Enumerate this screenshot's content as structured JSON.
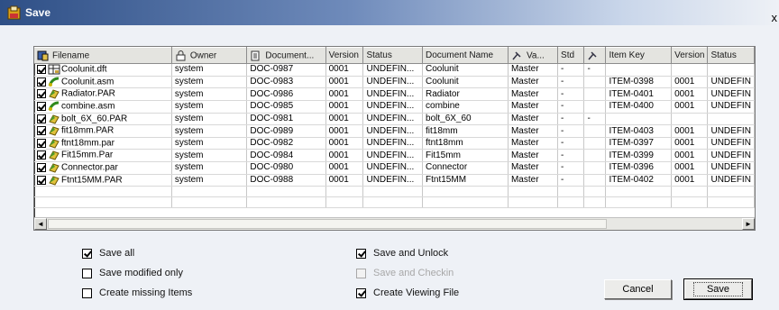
{
  "window": {
    "title": "Save",
    "title_icon": "save-dialog-icon",
    "close_label": "x"
  },
  "grid": {
    "columns": [
      {
        "label": "Filename",
        "icon": "file-type-icon"
      },
      {
        "label": "Owner",
        "icon": "owner-icon"
      },
      {
        "label": "Document...",
        "icon": "document-icon"
      },
      {
        "label": "Version",
        "icon": ""
      },
      {
        "label": "Status",
        "icon": ""
      },
      {
        "label": "Document Name",
        "icon": ""
      },
      {
        "label": "Va...",
        "icon": "pin-icon"
      },
      {
        "label": "Std",
        "icon": ""
      },
      {
        "label": "",
        "icon": "pin-icon"
      },
      {
        "label": "Item Key",
        "icon": ""
      },
      {
        "label": "Version",
        "icon": ""
      },
      {
        "label": "Status",
        "icon": ""
      }
    ],
    "rows": [
      {
        "checked": true,
        "icon": "draft-file-icon",
        "filename": "Coolunit.dft",
        "owner": "system",
        "document": "DOC-0987",
        "version": "0001",
        "status": "UNDEFIN...",
        "doc_name": "Coolunit",
        "variant": "Master",
        "std": "-",
        "extra": "-",
        "item_key": "",
        "item_version": "",
        "item_status": ""
      },
      {
        "checked": true,
        "icon": "assembly-file-icon",
        "filename": "Coolunit.asm",
        "owner": "system",
        "document": "DOC-0983",
        "version": "0001",
        "status": "UNDEFIN...",
        "doc_name": "Coolunit",
        "variant": "Master",
        "std": "-",
        "extra": "",
        "item_key": "ITEM-0398",
        "item_version": "0001",
        "item_status": "UNDEFIN"
      },
      {
        "checked": true,
        "icon": "part-file-icon",
        "filename": "Radiator.PAR",
        "owner": "system",
        "document": "DOC-0986",
        "version": "0001",
        "status": "UNDEFIN...",
        "doc_name": "Radiator",
        "variant": "Master",
        "std": "-",
        "extra": "",
        "item_key": "ITEM-0401",
        "item_version": "0001",
        "item_status": "UNDEFIN"
      },
      {
        "checked": true,
        "icon": "assembly-file-icon",
        "filename": "combine.asm",
        "owner": "system",
        "document": "DOC-0985",
        "version": "0001",
        "status": "UNDEFIN...",
        "doc_name": "combine",
        "variant": "Master",
        "std": "-",
        "extra": "",
        "item_key": "ITEM-0400",
        "item_version": "0001",
        "item_status": "UNDEFIN"
      },
      {
        "checked": true,
        "icon": "part-file-icon",
        "filename": "bolt_6X_60.PAR",
        "owner": "system",
        "document": "DOC-0981",
        "version": "0001",
        "status": "UNDEFIN...",
        "doc_name": "bolt_6X_60",
        "variant": "Master",
        "std": "-",
        "extra": "-",
        "item_key": "",
        "item_version": "",
        "item_status": ""
      },
      {
        "checked": true,
        "icon": "part-file-icon",
        "filename": "fit18mm.PAR",
        "owner": "system",
        "document": "DOC-0989",
        "version": "0001",
        "status": "UNDEFIN...",
        "doc_name": "fit18mm",
        "variant": "Master",
        "std": "-",
        "extra": "",
        "item_key": "ITEM-0403",
        "item_version": "0001",
        "item_status": "UNDEFIN"
      },
      {
        "checked": true,
        "icon": "part-file-icon",
        "filename": "ftnt18mm.par",
        "owner": "system",
        "document": "DOC-0982",
        "version": "0001",
        "status": "UNDEFIN...",
        "doc_name": "ftnt18mm",
        "variant": "Master",
        "std": "-",
        "extra": "",
        "item_key": "ITEM-0397",
        "item_version": "0001",
        "item_status": "UNDEFIN"
      },
      {
        "checked": true,
        "icon": "part-file-icon",
        "filename": "Fit15mm.Par",
        "owner": "system",
        "document": "DOC-0984",
        "version": "0001",
        "status": "UNDEFIN...",
        "doc_name": "Fit15mm",
        "variant": "Master",
        "std": "-",
        "extra": "",
        "item_key": "ITEM-0399",
        "item_version": "0001",
        "item_status": "UNDEFIN"
      },
      {
        "checked": true,
        "icon": "part-file-icon",
        "filename": "Connector.par",
        "owner": "system",
        "document": "DOC-0980",
        "version": "0001",
        "status": "UNDEFIN...",
        "doc_name": "Connector",
        "variant": "Master",
        "std": "-",
        "extra": "",
        "item_key": "ITEM-0396",
        "item_version": "0001",
        "item_status": "UNDEFIN"
      },
      {
        "checked": true,
        "icon": "part-file-icon",
        "filename": "Ftnt15MM.PAR",
        "owner": "system",
        "document": "DOC-0988",
        "version": "0001",
        "status": "UNDEFIN...",
        "doc_name": "Ftnt15MM",
        "variant": "Master",
        "std": "-",
        "extra": "",
        "item_key": "ITEM-0402",
        "item_version": "0001",
        "item_status": "UNDEFIN"
      }
    ],
    "scroll_left": "◄",
    "scroll_right": "►"
  },
  "options": {
    "save_all": {
      "label": "Save all",
      "checked": true,
      "enabled": true
    },
    "save_modified_only": {
      "label": "Save modified only",
      "checked": false,
      "enabled": true
    },
    "create_missing_items": {
      "label": "Create missing Items",
      "checked": false,
      "enabled": true
    },
    "save_and_unlock": {
      "label": "Save and Unlock",
      "checked": true,
      "enabled": true
    },
    "save_and_checkin": {
      "label": "Save and Checkin",
      "checked": false,
      "enabled": false
    },
    "create_viewing_file": {
      "label": "Create Viewing File",
      "checked": true,
      "enabled": true
    }
  },
  "buttons": {
    "cancel": "Cancel",
    "save": "Save"
  }
}
